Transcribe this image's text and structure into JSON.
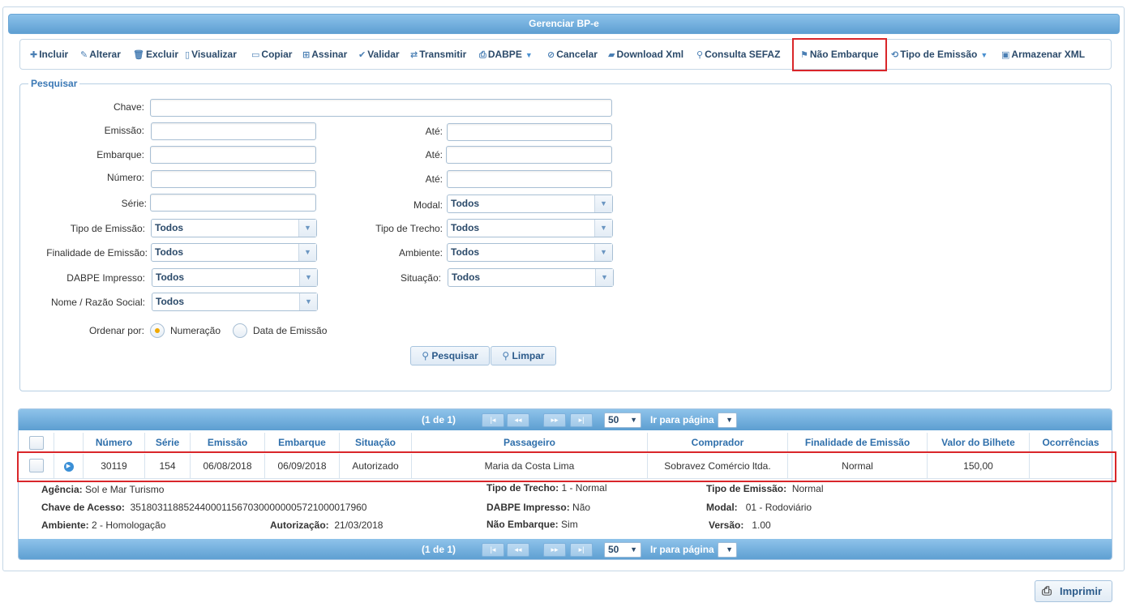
{
  "title": "Gerenciar BP-e",
  "toolbar": {
    "incluir": "Incluir",
    "alterar": "Alterar",
    "excluir": "Excluir",
    "visualizar": "Visualizar",
    "copiar": "Copiar",
    "assinar": "Assinar",
    "validar": "Validar",
    "transmitir": "Transmitir",
    "dabpe": "DABPE",
    "cancelar": "Cancelar",
    "download_xml": "Download Xml",
    "consulta_sefaz": "Consulta SEFAZ",
    "nao_embarque": "Não Embarque",
    "tipo_emissao": "Tipo de Emissão",
    "armazenar_xml": "Armazenar XML"
  },
  "search": {
    "legend": "Pesquisar",
    "chave": "Chave:",
    "emissao": "Emissão:",
    "embarque": "Embarque:",
    "numero": "Número:",
    "serie": "Série:",
    "ate": "Até:",
    "modal": "Modal:",
    "tipo_emissao": "Tipo de Emissão:",
    "tipo_trecho": "Tipo de Trecho:",
    "finalidade": "Finalidade de Emissão:",
    "ambiente": "Ambiente:",
    "dabpe_impresso": "DABPE Impresso:",
    "situacao": "Situação:",
    "nome_razao": "Nome / Razão Social:",
    "todos": "Todos",
    "ordenar_por": "Ordenar por:",
    "numeracao": "Numeração",
    "data_emissao": "Data de Emissão",
    "pesquisar_btn": "Pesquisar",
    "limpar_btn": "Limpar"
  },
  "pager": {
    "page_info": "(1 de 1)",
    "rows_per_page": "50",
    "goto_label": "Ir para página"
  },
  "table": {
    "columns": [
      "Número",
      "Série",
      "Emissão",
      "Embarque",
      "Situação",
      "Passageiro",
      "Comprador",
      "Finalidade de Emissão",
      "Valor do Bilhete",
      "Ocorrências"
    ],
    "row": {
      "numero": "30119",
      "serie": "154",
      "emissao": "06/08/2018",
      "embarque": "06/09/2018",
      "situacao": "Autorizado",
      "passageiro": "Maria da Costa Lima",
      "comprador": "Sobravez Comércio ltda.",
      "finalidade": "Normal",
      "valor": "150,00",
      "ocorrencias": ""
    }
  },
  "details": {
    "agencia_label": "Agência:",
    "agencia_value": "Sol e Mar Turismo",
    "chave_label": "Chave de Acesso:",
    "chave_value": "35180311885244000115670300000005721000017960",
    "ambiente_label": "Ambiente:",
    "ambiente_value": "2 - Homologação",
    "autorizacao_label": "Autorização:",
    "autorizacao_value": "21/03/2018",
    "tipo_trecho_label": "Tipo de Trecho:",
    "tipo_trecho_value": "1 - Normal",
    "dabpe_label": "DABPE Impresso:",
    "dabpe_value": "Não",
    "nao_embarque_label": "Não Embarque:",
    "nao_embarque_value": "Sim",
    "tipo_emissao_label": "Tipo de Emissão:",
    "tipo_emissao_value": "Normal",
    "modal_label": "Modal:",
    "modal_value": "01 - Rodoviário",
    "versao_label": "Versão:",
    "versao_value": "1.00"
  },
  "print_label": "Imprimir",
  "colors": {
    "accent": "#5e9fd2",
    "highlight": "#d9262a",
    "radio_selected": "#f0a800"
  }
}
